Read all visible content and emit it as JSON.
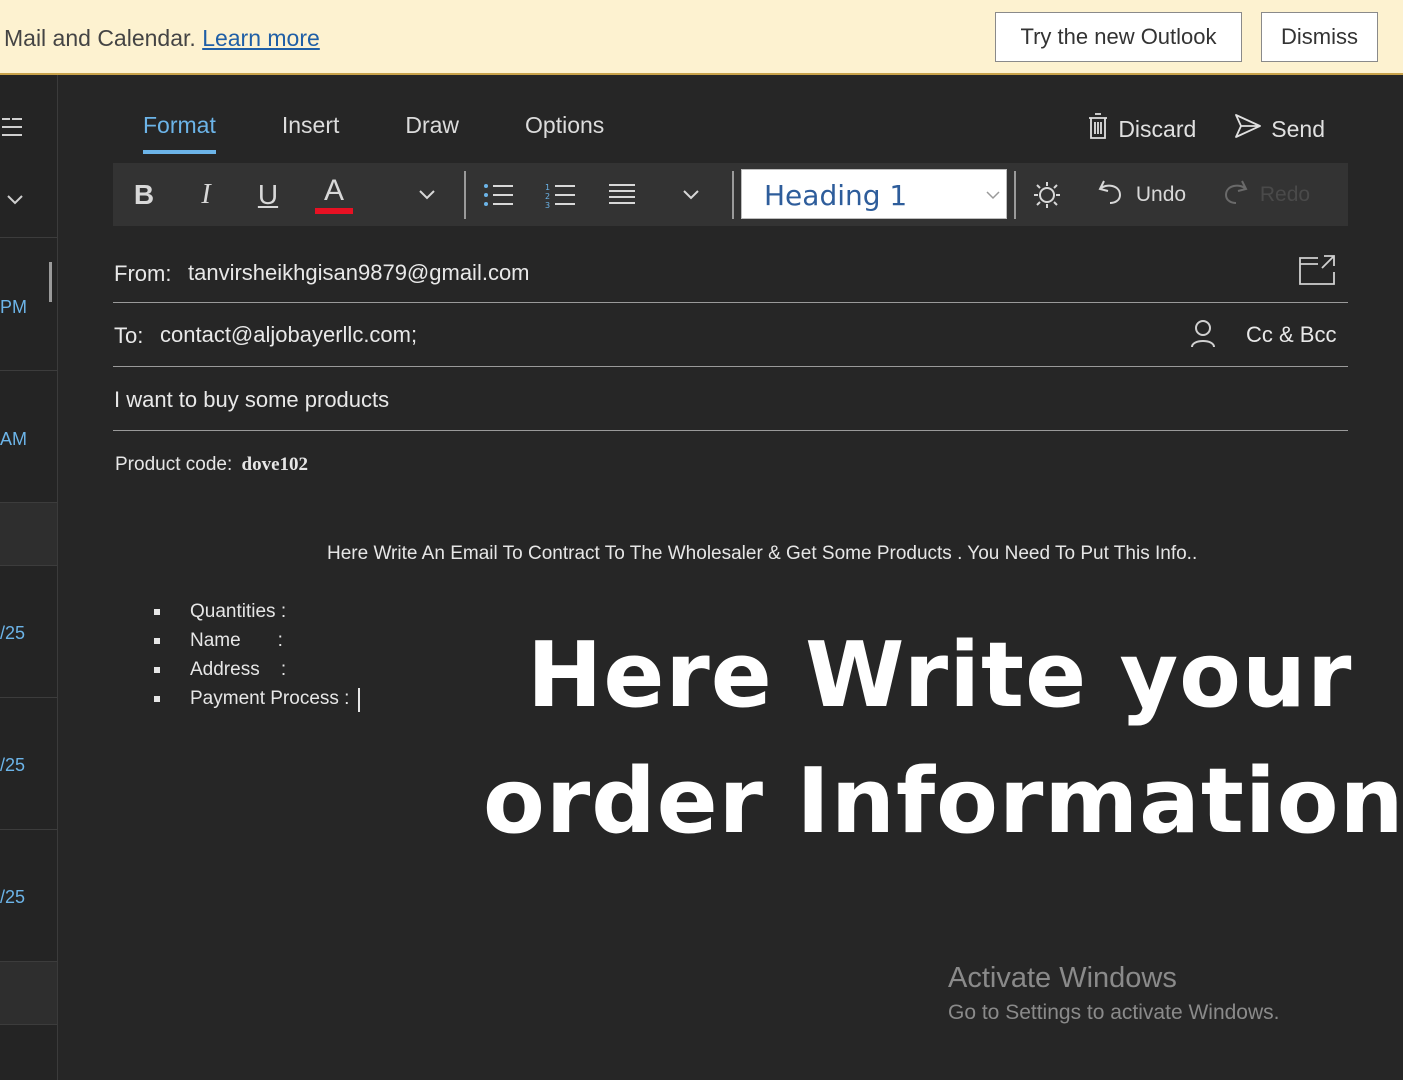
{
  "banner": {
    "text": "Mail and Calendar.",
    "link": "Learn more",
    "try_button": "Try the new Outlook",
    "dismiss_button": "Dismiss"
  },
  "message_list": {
    "times": [
      "PM",
      "AM",
      "/25",
      "/25",
      "/25"
    ]
  },
  "compose": {
    "tabs": [
      "Format",
      "Insert",
      "Draw",
      "Options"
    ],
    "active_tab": "Format",
    "discard_label": "Discard",
    "send_label": "Send",
    "toolbar": {
      "bold": "B",
      "italic": "I",
      "underline": "U",
      "font_color": "A",
      "font_color_hex": "#e81123",
      "style_value": "Heading 1",
      "undo_label": "Undo",
      "redo_label": "Redo"
    },
    "from_label": "From:",
    "from_value": "tanvirsheikhgisan9879@gmail.com",
    "to_label": "To:",
    "to_value": "contact@aljobayerllc.com;",
    "cc_bcc_label": "Cc & Bcc",
    "subject": "I want to buy some products"
  },
  "body": {
    "product_code_label": "Product code:",
    "product_code_value": "dove102",
    "instruction": "Here Write An Email To Contract To The Wholesaler & Get Some Products  . You Need To Put This  Info..",
    "bullets": [
      "Quantities :",
      "Name       :",
      "Address    :",
      "Payment Process :"
    ]
  },
  "overlay": {
    "line1": "Here Write your",
    "line2": "order Information"
  },
  "watermark": {
    "title": "Activate Windows",
    "subtitle": "Go to Settings to activate Windows."
  },
  "colors": {
    "accent": "#6cb4e8",
    "background": "#262626",
    "banner": "#fdf2d0"
  }
}
